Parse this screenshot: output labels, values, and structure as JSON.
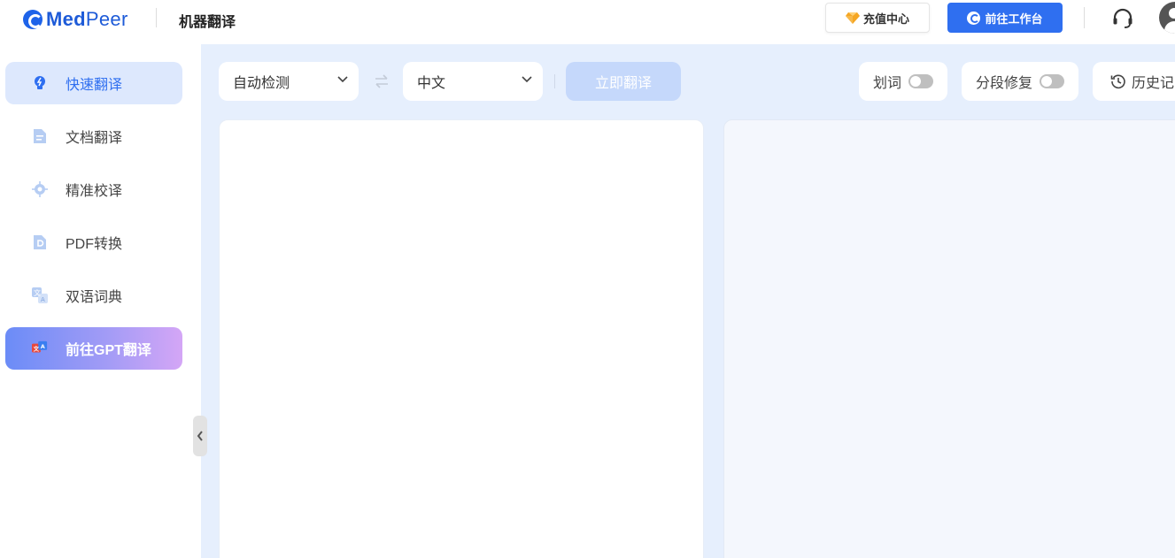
{
  "header": {
    "brand_bold": "Med",
    "brand_light": "Peer",
    "title": "机器翻译",
    "recharge_label": "充值中心",
    "workbench_label": "前往工作台"
  },
  "sidebar": {
    "items": [
      {
        "label": "快速翻译",
        "icon": "bulb-icon",
        "active": true
      },
      {
        "label": "文档翻译",
        "icon": "document-icon"
      },
      {
        "label": "精准校译",
        "icon": "target-icon"
      },
      {
        "label": "PDF转换",
        "icon": "pdf-icon"
      },
      {
        "label": "双语词典",
        "icon": "dictionary-icon"
      },
      {
        "label": "前往GPT翻译",
        "icon": "gpt-translate-icon"
      }
    ]
  },
  "toolbar": {
    "source_lang": "自动检测",
    "target_lang": "中文",
    "translate_label": "立即翻译",
    "word_select_label": "划词",
    "word_select_on": false,
    "segment_fix_label": "分段修复",
    "segment_fix_on": false,
    "history_label": "历史记录"
  },
  "editor": {
    "source_text": "",
    "target_text": ""
  },
  "colors": {
    "accent": "#2f6ff0",
    "active_bg": "#dde8fd",
    "page_bg": "#e6effd",
    "translate_disabled": "#c5d8fb"
  }
}
